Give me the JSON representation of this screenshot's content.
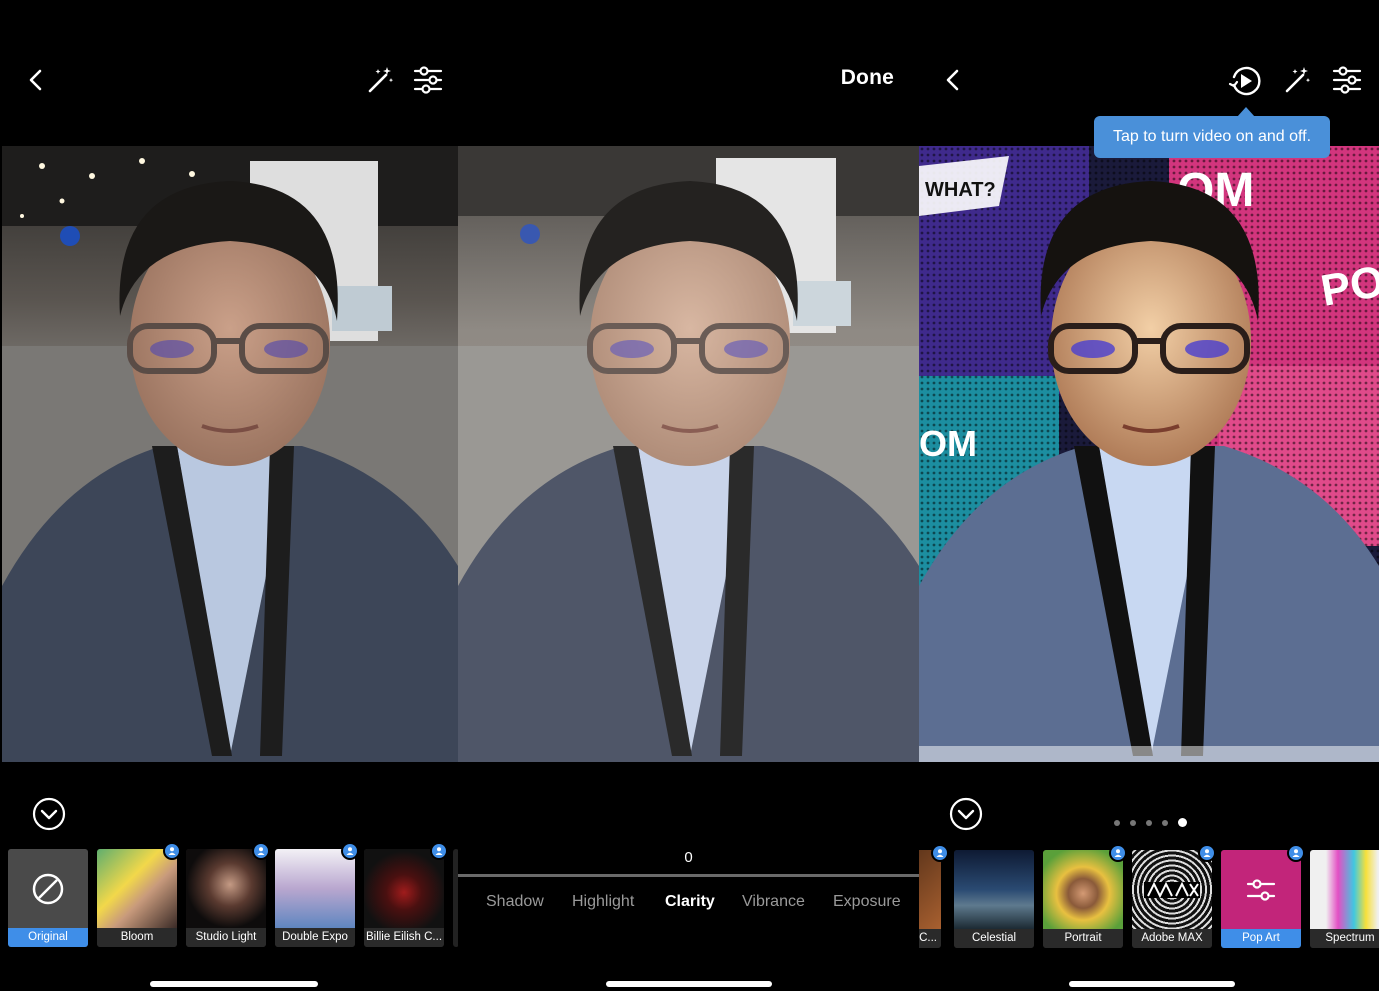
{
  "panel1": {
    "filters": [
      {
        "label": "Original",
        "selected": true,
        "premium": false,
        "icon": "none-circle-slash-icon"
      },
      {
        "label": "Bloom",
        "selected": false,
        "premium": true
      },
      {
        "label": "Studio Light",
        "selected": false,
        "premium": true
      },
      {
        "label": "Double Expo",
        "selected": false,
        "premium": true
      },
      {
        "label": "Billie Eilish C...",
        "selected": false,
        "premium": true
      }
    ]
  },
  "panel2": {
    "done_label": "Done",
    "slider_value": "0",
    "tabs": [
      {
        "label": "Shadow",
        "active": false
      },
      {
        "label": "Highlight",
        "active": false
      },
      {
        "label": "Clarity",
        "active": true
      },
      {
        "label": "Vibrance",
        "active": false
      },
      {
        "label": "Exposure",
        "active": false
      }
    ]
  },
  "panel3": {
    "tooltip": "Tap to turn video on and off.",
    "page_dots": {
      "count": 5,
      "active_index": 4
    },
    "filters": [
      {
        "label": "C...",
        "selected": false,
        "premium": true
      },
      {
        "label": "Celestial",
        "selected": false,
        "premium": false
      },
      {
        "label": "Portrait",
        "selected": false,
        "premium": true
      },
      {
        "label": "Adobe MAX",
        "selected": false,
        "premium": true
      },
      {
        "label": "Pop Art",
        "selected": true,
        "premium": true,
        "icon": "sliders-icon"
      },
      {
        "label": "Spectrum",
        "selected": false,
        "premium": false
      }
    ],
    "popart_words": [
      "WHAT?",
      "OM",
      "PO",
      "OM"
    ]
  },
  "colors": {
    "accent": "#3f8ee8",
    "tooltip": "#4a90d9",
    "background": "#000000"
  }
}
